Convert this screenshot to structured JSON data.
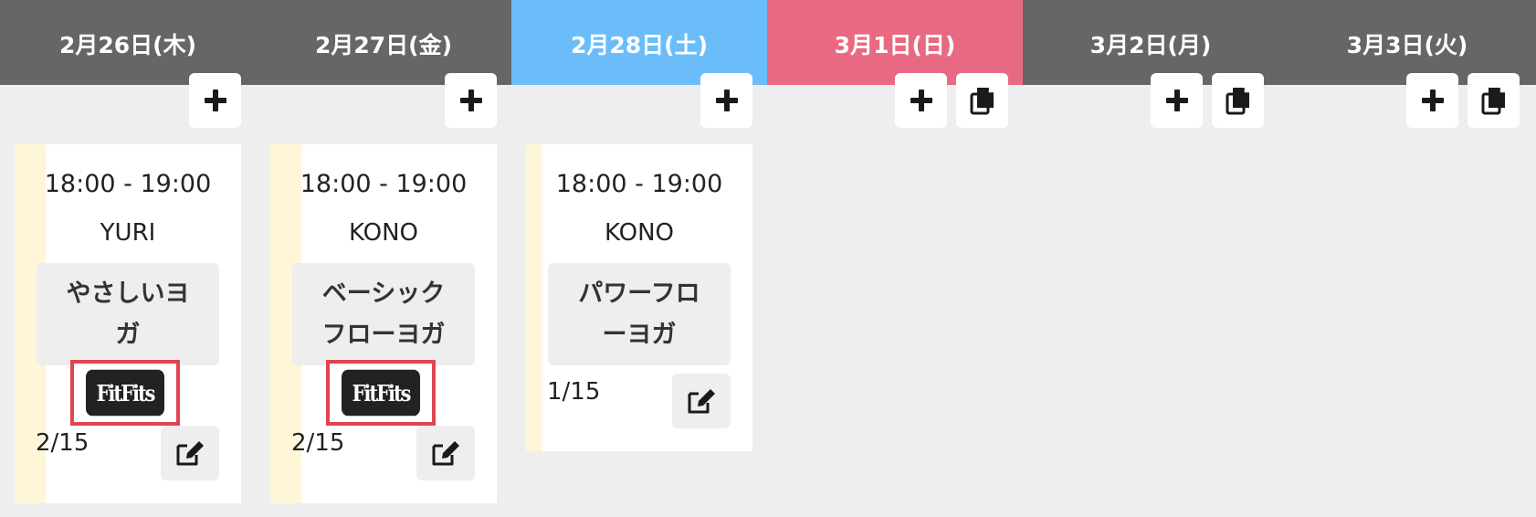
{
  "days": [
    {
      "label": "2月26日(木)",
      "color": "#666666"
    },
    {
      "label": "2月27日(金)",
      "color": "#666666"
    },
    {
      "label": "2月28日(土)",
      "color": "#6bbdf9"
    },
    {
      "label": "3月1日(日)",
      "color": "#e86a82"
    },
    {
      "label": "3月2日(月)",
      "color": "#666666"
    },
    {
      "label": "3月3日(火)",
      "color": "#666666"
    }
  ],
  "icons": {
    "add": "plus-icon",
    "copy": "copy-icon",
    "edit": "edit-icon"
  },
  "lessons": [
    {
      "time": "18:00 - 19:00",
      "instructor": "YURI",
      "title_line1": "やさしいヨ",
      "title_line2": "ガ",
      "badge": "FitFits",
      "count": "2/15",
      "stripe_color": "#fff6d9"
    },
    {
      "time": "18:00 - 19:00",
      "instructor": "KONO",
      "title_line1": "ベーシック",
      "title_line2": "フローヨガ",
      "badge": "FitFits",
      "count": "2/15",
      "stripe_color": "#fff6d9"
    },
    {
      "time": "18:00 - 19:00",
      "instructor": "KONO",
      "title_line1": "パワーフロ",
      "title_line2": "ーヨガ",
      "count": "1/15",
      "stripe_color": "#fff6d9"
    }
  ],
  "colors": {
    "highlight_border": "#e04553",
    "background": "#eeeeee"
  }
}
